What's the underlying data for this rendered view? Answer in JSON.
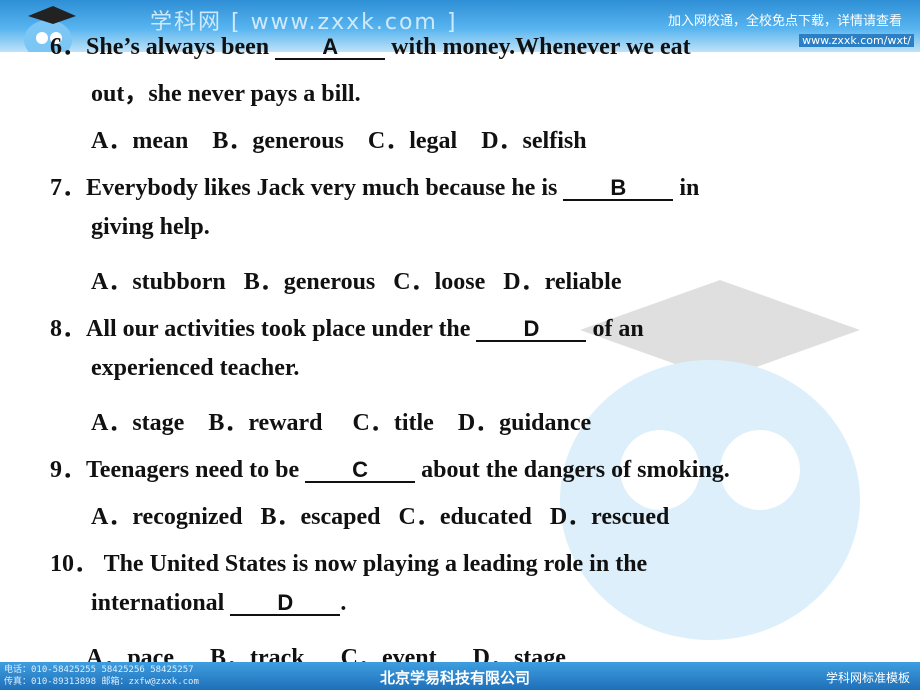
{
  "header": {
    "site": "学科网 [ www.zxxk.com ]",
    "promo": "加入网校通，全校免点下载，详情请查看",
    "url": "www.zxxk.com/wxt/"
  },
  "questions": [
    {
      "num": "6．",
      "before": "She’s always been ",
      "answer": "A",
      "after": " with money.Whenever we eat",
      "cont": "out，she never pays a bill.",
      "options": "A．mean    B．generous    C．legal    D．selfish"
    },
    {
      "num": "7．",
      "before": "Everybody likes Jack very much because he is ",
      "answer": "B",
      "after": " in",
      "cont": "giving help.",
      "options": "A．stubborn   B．generous   C．loose   D．reliable"
    },
    {
      "num": "8．",
      "before": "All our activities took place under the ",
      "answer": "D",
      "after": " of an",
      "cont": "experienced teacher.",
      "options": "A．stage    B．reward     C．title    D．guidance"
    },
    {
      "num": "9．",
      "before": "Teenagers need to be ",
      "answer": "C",
      "after": " about the dangers of smoking.",
      "options": "A．recognized   B．escaped   C．educated   D．rescued"
    },
    {
      "num": "10．",
      "before": " The United States is now playing a leading role in the",
      "cont_before": "international ",
      "answer": "D",
      "cont_after": ".",
      "options": "A．pace      B．track      C．event      D．stage"
    }
  ],
  "footer": {
    "phone": "电话：010-58425255  58425256  58425257",
    "fax": "传真：010-89313898  邮箱：zxfw@zxxk.com",
    "company": "北京学易科技有限公司",
    "template": "学科网标准模板"
  }
}
